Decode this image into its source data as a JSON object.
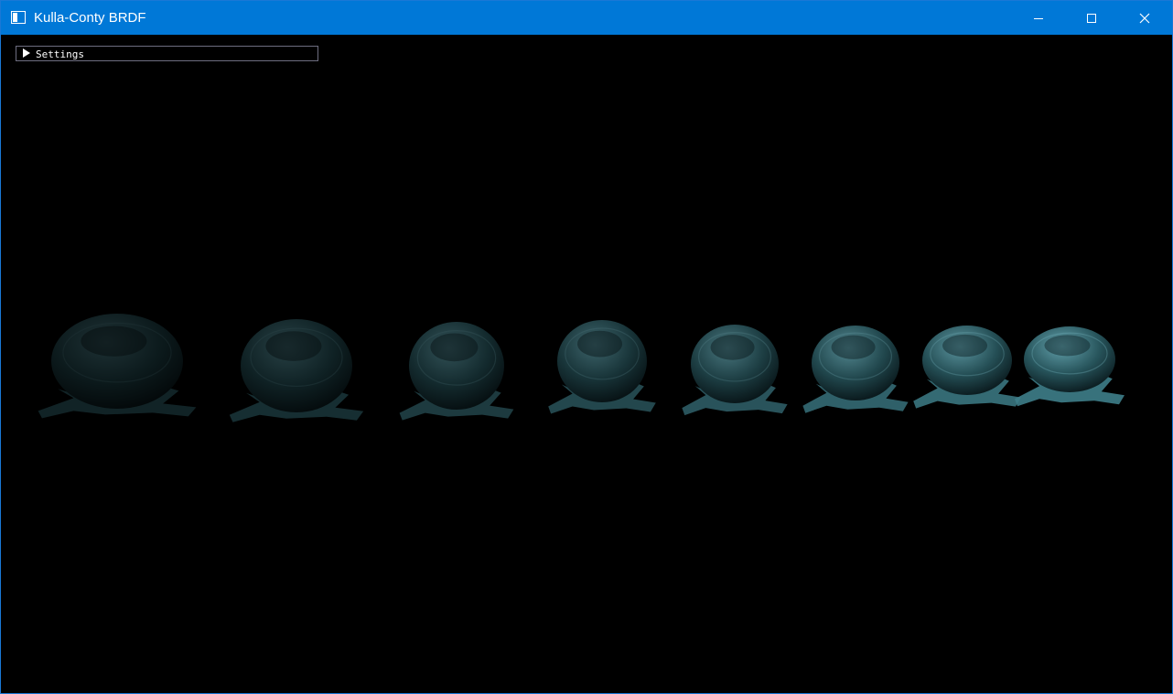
{
  "window": {
    "title": "Kulla-Conty BRDF",
    "accent_color": "#0078d7",
    "controls": {
      "minimize_icon": "minimize-icon",
      "maximize_icon": "maximize-icon",
      "close_icon": "close-icon"
    }
  },
  "settings_panel": {
    "label": "Settings",
    "collapsed": true,
    "arrow_icon": "triangle-right-icon"
  },
  "scene": {
    "object_count": 8,
    "material_color": "#3f7f8a",
    "background_color": "#000000"
  }
}
